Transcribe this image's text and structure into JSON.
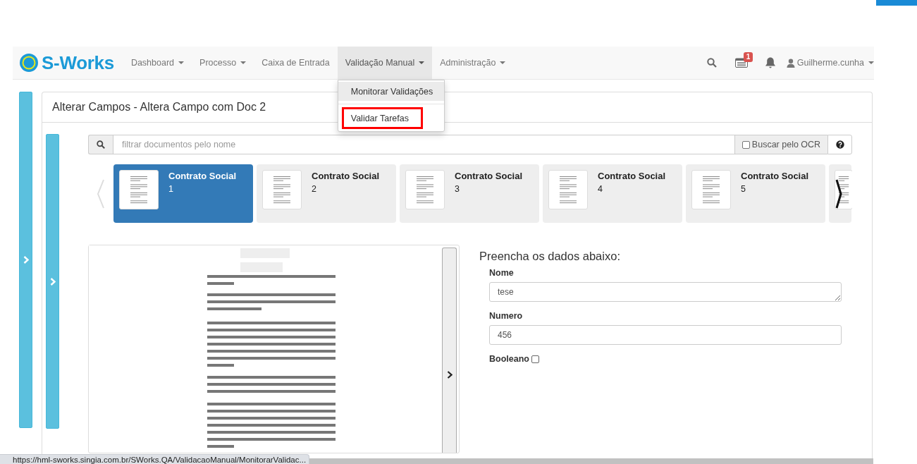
{
  "nav": {
    "brand": "S-Works",
    "items": [
      {
        "label": "Dashboard",
        "dropdown": true,
        "selected": false
      },
      {
        "label": "Processo",
        "dropdown": true,
        "selected": false
      },
      {
        "label": "Caixa de Entrada",
        "dropdown": false,
        "selected": false
      },
      {
        "label": "Validação Manual",
        "dropdown": true,
        "selected": true
      },
      {
        "label": "Administração",
        "dropdown": true,
        "selected": false
      }
    ],
    "badge": "1",
    "user": "Guilherme.cunha"
  },
  "dropdown_menu": {
    "items": [
      {
        "label": "Monitorar Validações",
        "hovered": true,
        "highlighted": false
      },
      {
        "label": "Validar Tarefas",
        "hovered": false,
        "highlighted": true
      }
    ]
  },
  "panel": {
    "title": "Alterar Campos - Altera Campo com Doc 2"
  },
  "filter": {
    "placeholder": "filtrar documentos pelo nome",
    "ocr_label": "Buscar pelo OCR",
    "ocr_checked": false
  },
  "carousel": {
    "documents": [
      {
        "kind": "card",
        "title": "Contrato Social",
        "number": "1",
        "selected": true
      },
      {
        "kind": "card",
        "title": "Contrato Social",
        "number": "2",
        "selected": false
      },
      {
        "kind": "card",
        "title": "Contrato Social",
        "number": "3",
        "selected": false
      },
      {
        "kind": "card",
        "title": "Contrato Social",
        "number": "4",
        "selected": false
      },
      {
        "kind": "card",
        "title": "Contrato Social",
        "number": "5",
        "selected": false
      },
      {
        "kind": "partial",
        "selected": false
      }
    ]
  },
  "form": {
    "heading": "Preencha os dados abaixo:",
    "fields": [
      {
        "kind": "textarea",
        "label": "Nome",
        "value": "tese"
      },
      {
        "kind": "input",
        "label": "Numero",
        "value": "456"
      },
      {
        "kind": "checkbox",
        "label": "Booleano",
        "checked": false
      }
    ]
  },
  "status_bar": {
    "url": "https://hml-sworks.singia.com.br/SWorks.QA/ValidacaoManual/MonitorarValidac..."
  }
}
